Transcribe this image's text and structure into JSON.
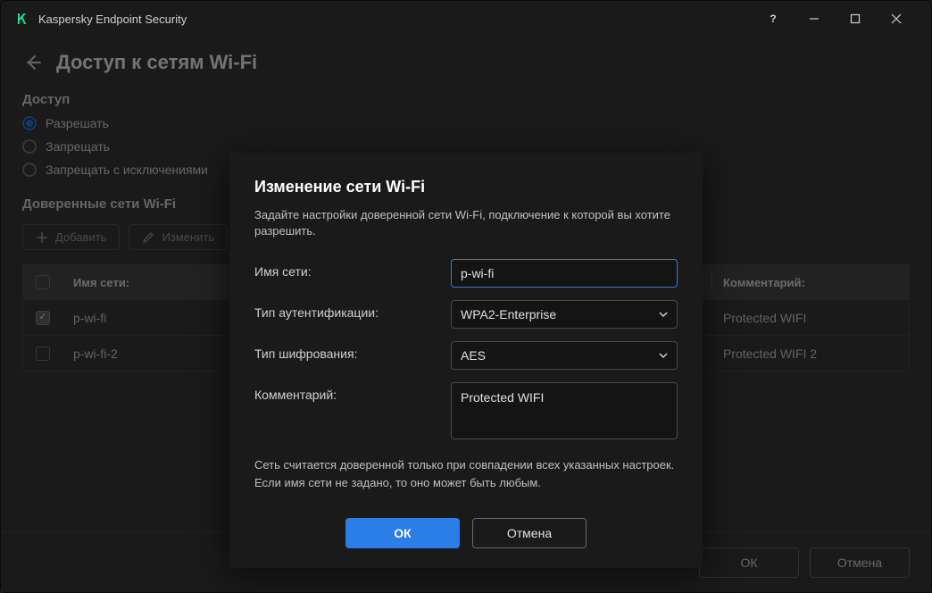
{
  "titlebar": {
    "app_name": "Kaspersky Endpoint Security"
  },
  "page": {
    "title": "Доступ к сетям Wi-Fi"
  },
  "access": {
    "label": "Доступ",
    "options": [
      {
        "label": "Разрешать",
        "checked": true
      },
      {
        "label": "Запрещать",
        "checked": false
      },
      {
        "label": "Запрещать с исключениями",
        "checked": false
      }
    ]
  },
  "trusted": {
    "title": "Доверенные сети Wi-Fi",
    "add_btn": "Добавить",
    "edit_btn": "Изменить"
  },
  "table": {
    "col_name": "Имя сети:",
    "col_comment": "Комментарий:",
    "rows": [
      {
        "checked": true,
        "name": "p-wi-fi",
        "comment": "Protected WIFI"
      },
      {
        "checked": false,
        "name": "p-wi-fi-2",
        "comment": "Protected WIFI 2"
      }
    ]
  },
  "footer": {
    "ok": "ОК",
    "cancel": "Отмена"
  },
  "modal": {
    "title": "Изменение сети Wi-Fi",
    "desc": "Задайте настройки доверенной сети Wi-Fi, подключение к которой вы хотите разрешить.",
    "name_label": "Имя сети:",
    "name_value": "p-wi-fi",
    "auth_label": "Тип аутентификации:",
    "auth_value": "WPA2-Enterprise",
    "enc_label": "Тип шифрования:",
    "enc_value": "AES",
    "comment_label": "Комментарий:",
    "comment_value": "Protected WIFI",
    "note": "Сеть считается доверенной только при совпадении всех указанных настроек. Если имя сети не задано, то оно может быть любым.",
    "ok": "ОК",
    "cancel": "Отмена"
  }
}
